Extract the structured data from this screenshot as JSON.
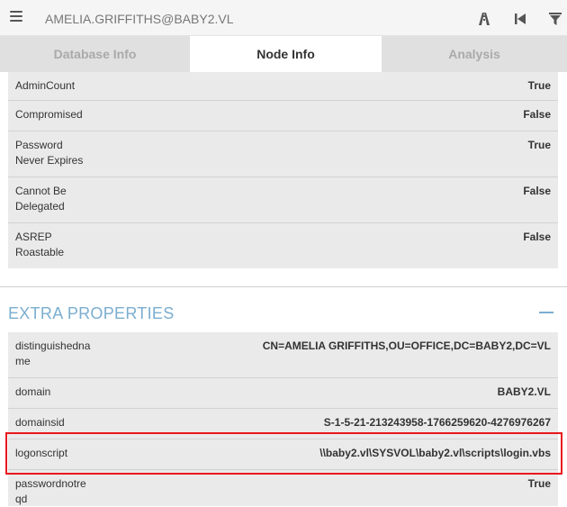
{
  "header": {
    "search_value": "AMELIA.GRIFFITHS@BABY2.VL",
    "icons": [
      "menu-icon",
      "pathfinding-icon",
      "back-icon",
      "filter-icon"
    ]
  },
  "tabs": [
    {
      "label": "Database Info",
      "active": false
    },
    {
      "label": "Node Info",
      "active": true
    },
    {
      "label": "Analysis",
      "active": false
    }
  ],
  "node_properties": [
    {
      "key": "AdminCount",
      "value": "True"
    },
    {
      "key": "Compromised",
      "value": "False"
    },
    {
      "key": "Password\nNever Expires",
      "value": "True"
    },
    {
      "key": "Cannot Be\nDelegated",
      "value": "False"
    },
    {
      "key": "ASREP\nRoastable",
      "value": "False"
    }
  ],
  "extra_section": {
    "title": "EXTRA PROPERTIES",
    "rows": [
      {
        "key": "distinguishedna\nme",
        "value": "CN=AMELIA GRIFFITHS,OU=OFFICE,DC=BABY2,DC=VL"
      },
      {
        "key": "domain",
        "value": "BABY2.VL"
      },
      {
        "key": "domainsid",
        "value": "S-1-5-21-213243958-1766259620-4276976267"
      },
      {
        "key": "logonscript",
        "value": "\\\\baby2.vl\\SYSVOL\\baby2.vl\\scripts\\login.vbs"
      },
      {
        "key": "passwordnotre\nqd",
        "value": "True"
      }
    ]
  },
  "colors": {
    "accent": "#7aaed0",
    "highlight": "#e8181d",
    "row_bg": "#eaeaea",
    "tab_inactive": "#e0e0e0"
  }
}
